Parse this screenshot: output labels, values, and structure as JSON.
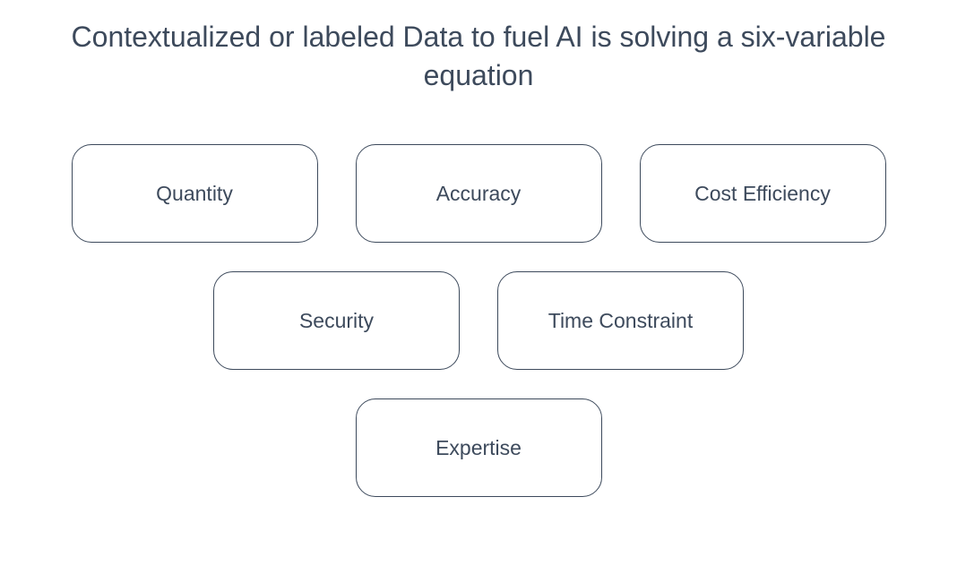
{
  "title": "Contextualized or labeled Data to fuel AI is solving a six-variable equation",
  "rows": [
    {
      "items": [
        "Quantity",
        "Accuracy",
        "Cost Efficiency"
      ]
    },
    {
      "items": [
        "Security",
        "Time Constraint"
      ]
    },
    {
      "items": [
        "Expertise"
      ]
    }
  ]
}
